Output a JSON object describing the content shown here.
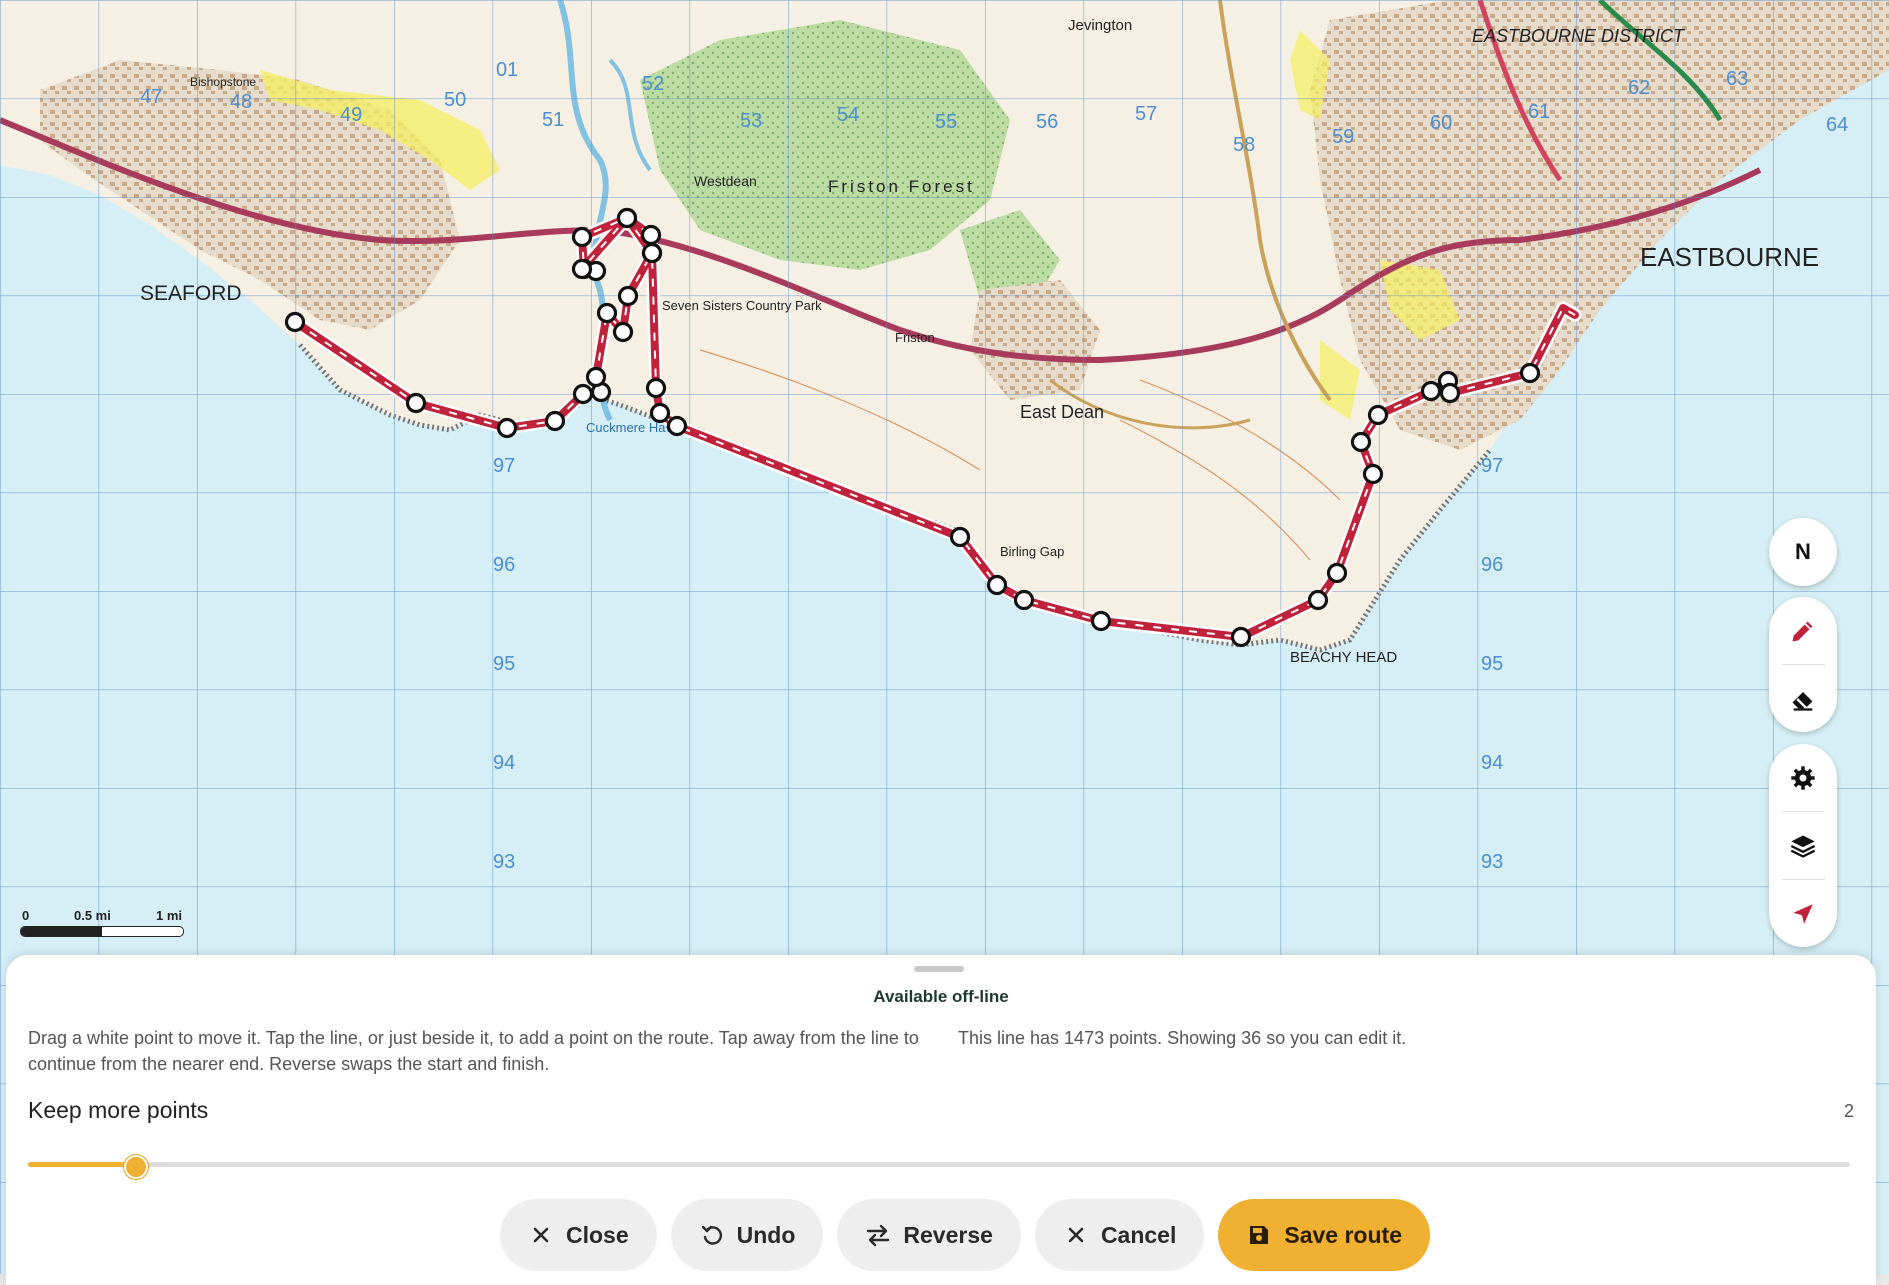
{
  "map": {
    "place_labels": {
      "seaford": "SEAFORD",
      "eastbourne": "EASTBOURNE",
      "east_dean": "East Dean",
      "friston_forest": "Friston Forest",
      "beachy_head": "BEACHY HEAD",
      "eastbourne_district": "EASTBOURNE DISTRICT",
      "jevington": "Jevington",
      "seven_sisters": "Seven Sisters Country Park",
      "cuckmere_haven": "Cuckmere Haven",
      "westdean": "Westdean",
      "birling_gap": "Birling Gap",
      "friston": "Friston",
      "bishopstone": "Bishopstone"
    },
    "grid_labels_top": [
      "47",
      "48",
      "49",
      "50",
      "01",
      "51",
      "52",
      "53",
      "54",
      "55",
      "56",
      "57",
      "58",
      "59",
      "60",
      "61",
      "62",
      "63",
      "64"
    ],
    "grid_labels_side": [
      "97",
      "96",
      "95",
      "94",
      "93"
    ],
    "route_color": "#c0213b",
    "point_count": 36
  },
  "tools": {
    "north_label": "N",
    "icons": [
      "pencil-icon",
      "eraser-icon",
      "settings-icon",
      "layers-icon",
      "locate-icon"
    ]
  },
  "scale": {
    "zero": "0",
    "half": "0.5 mi",
    "one": "1 mi"
  },
  "panel": {
    "offline_label": "Available off-line",
    "help_text": "Drag a white point to move it. Tap the line, or just beside it, to add a point on the route. Tap away from the line to continue from the nearer end. Reverse swaps the start and finish.",
    "points_text": "This line has 1473 points. Showing 36 so you can edit it.",
    "keep_label": "Keep more points",
    "keep_value": "2",
    "keep_fraction": 0.058,
    "buttons": {
      "close": "Close",
      "undo": "Undo",
      "reverse": "Reverse",
      "cancel": "Cancel",
      "save": "Save route"
    }
  },
  "colors": {
    "accent": "#f0b133",
    "sea": "#d6eff6",
    "land": "#f6f0e4",
    "wood": "#b9d9a0",
    "urban": "#d8c8b8"
  }
}
